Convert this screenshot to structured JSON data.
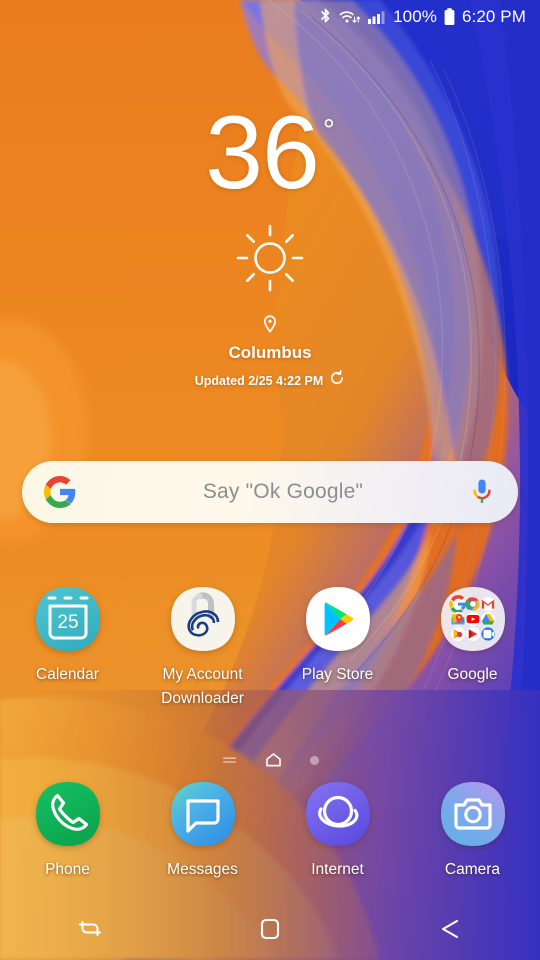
{
  "status_bar": {
    "icons": [
      "bluetooth-icon",
      "wifi-icon",
      "cellular-signal-icon"
    ],
    "battery_percent": "100%",
    "battery_icon": "battery-full-icon",
    "time": "6:20 PM"
  },
  "weather": {
    "temperature": "36",
    "degree_symbol": "°",
    "condition_icon": "sun-icon",
    "location_icon": "location-pin-icon",
    "city": "Columbus",
    "updated": "Updated 2/25 4:22 PM",
    "refresh_icon": "refresh-icon"
  },
  "search": {
    "logo_icon": "google-g-icon",
    "placeholder": "Say \"Ok Google\"",
    "mic_icon": "google-mic-icon"
  },
  "apps": {
    "row1": [
      {
        "label": "Calendar",
        "icon": "calendar-icon",
        "badge": "25"
      },
      {
        "label": "My Account Downloader",
        "icon": "my-account-downloader-icon"
      },
      {
        "label": "Play Store",
        "icon": "play-store-icon"
      },
      {
        "label": "Google",
        "icon": "google-folder-icon",
        "folder_apps": [
          "google-icon",
          "chrome-icon",
          "gmail-icon",
          "maps-icon",
          "youtube-icon",
          "drive-icon",
          "play-music-icon",
          "play-movies-icon",
          "duo-icon"
        ]
      }
    ]
  },
  "dock": [
    {
      "label": "Phone",
      "icon": "phone-icon"
    },
    {
      "label": "Messages",
      "icon": "messages-icon"
    },
    {
      "label": "Internet",
      "icon": "internet-icon"
    },
    {
      "label": "Camera",
      "icon": "camera-icon"
    }
  ],
  "page_indicator": {
    "pages": [
      "bixby-page-icon",
      "home-page-icon",
      "page-dot"
    ],
    "active_index": 1
  },
  "nav_bar": {
    "recents_icon": "recents-icon",
    "home_icon": "home-icon",
    "back_icon": "back-icon"
  },
  "colors": {
    "wallpaper_orange": "#F58220",
    "wallpaper_blue": "#2B3BE0",
    "wallpaper_purple": "#6A3FB5",
    "calendar_teal": "#3FBBC9",
    "phone_green": "#12B45A",
    "messages_blue": "#3E9BE8",
    "internet_purple": "#6C5CE7",
    "camera_blue": "#62A8E8",
    "search_text": "#8D8D92"
  }
}
